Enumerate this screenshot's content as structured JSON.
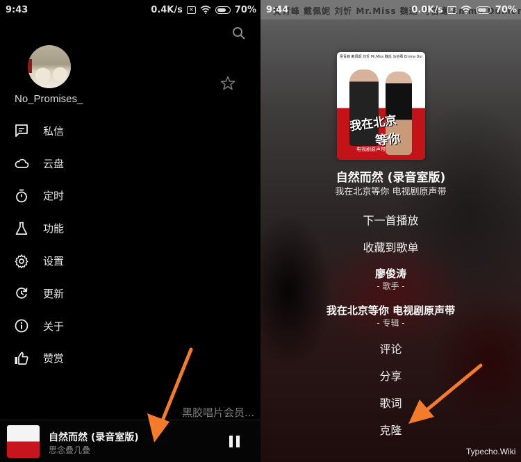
{
  "left_screen": {
    "status_bar": {
      "time": "9:43",
      "network_speed": "0.4K/s",
      "icons": [
        "sim-x-icon",
        "wifi-icon",
        "battery-icon"
      ],
      "battery": "70%"
    },
    "header": {
      "search_icon": "search-icon",
      "favorite_icon": "star-icon",
      "username": "No_Promises_"
    },
    "menu": [
      {
        "icon": "message-icon",
        "label": "私信"
      },
      {
        "icon": "cloud-icon",
        "label": "云盘"
      },
      {
        "icon": "timer-icon",
        "label": "定时"
      },
      {
        "icon": "flask-icon",
        "label": "功能"
      },
      {
        "icon": "gear-icon",
        "label": "设置"
      },
      {
        "icon": "update-icon",
        "label": "更新"
      },
      {
        "icon": "info-icon",
        "label": "关于"
      },
      {
        "icon": "thumbs-up-icon",
        "label": "赞赏"
      }
    ],
    "vinyl_note": "黑胶唱片会员...",
    "mini_player": {
      "title": "自然而然 (录音室版)",
      "subtitle": "思念叠几叠",
      "state": "playing",
      "pause_icon": "pause-icon"
    }
  },
  "right_screen": {
    "status_bar": {
      "time": "9:44",
      "network_speed": "0.0K/s",
      "battery": "70%"
    },
    "background_artists_text": "吴青峰  戴佩妮  刘忻  Mr.Miss  魏巡  马伯骞  Emma Dumont etc.",
    "album_art": {
      "caption": "吴青峰 戴佩妮 刘忻 Mr.Miss 魏巡 马伯骞 Emma Dumont etc.",
      "title_line1": "我在北京",
      "title_line2": "等你",
      "subtitle": "电视剧原声带"
    },
    "song": {
      "title": "自然而然 (录音室版)",
      "album": "我在北京等你 电视剧原声带"
    },
    "options": [
      {
        "label": "下一首播放"
      },
      {
        "label": "收藏到歌单"
      },
      {
        "label": "廖俊涛",
        "sub": "- 歌手 -"
      },
      {
        "label": "我在北京等你 电视剧原声带",
        "sub": "- 专辑 -"
      },
      {
        "label": "评论"
      },
      {
        "label": "分享"
      },
      {
        "label": "歌词"
      },
      {
        "label": "克隆"
      }
    ],
    "watermark": "Typecho.Wiki"
  },
  "annotations": {
    "arrow_color": "#f47b2a"
  }
}
